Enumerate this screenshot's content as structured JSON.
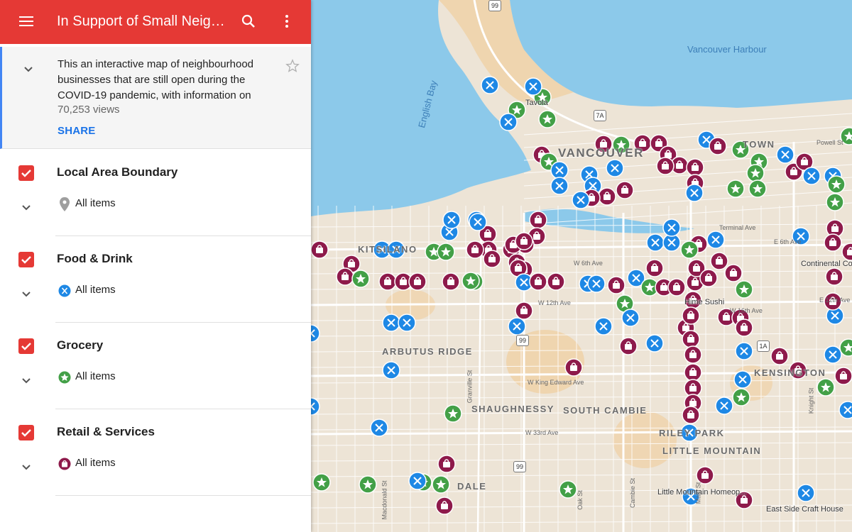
{
  "header": {
    "title": "In Support of Small Neighbourhood Businesses",
    "menu_icon": "hamburger-icon",
    "search_icon": "search-icon",
    "more_icon": "more-vert-icon",
    "bar_color": "#e53935"
  },
  "description": {
    "text": "This an interactive map of neighbourhood businesses that are still open during the COVID-19 pandemic, with information on",
    "views": "70,253 views",
    "share_label": "SHARE"
  },
  "layers": [
    {
      "name": "Local Area Boundary",
      "items_label": "All items",
      "icon": "gray-pin-icon",
      "color": "#9e9e9e"
    },
    {
      "name": "Food & Drink",
      "items_label": "All items",
      "icon": "fork-knife-icon",
      "color": "#1e88e5"
    },
    {
      "name": "Grocery",
      "items_label": "All items",
      "icon": "star-icon",
      "color": "#43a047"
    },
    {
      "name": "Retail & Services",
      "items_label": "All items",
      "icon": "shop-bag-icon",
      "color": "#8e1a4b"
    }
  ],
  "map": {
    "water_labels": [
      "Vancouver Harbour",
      "English Bay"
    ],
    "place_labels": [
      "Tavola",
      "Hime Sushi",
      "Continental Coffee",
      "Little Mountain Homeop...",
      "East Side Craft House"
    ],
    "area_labels": [
      "ARBUTUS RIDGE",
      "SHAUGHNESSY",
      "SOUTH CAMBIE",
      "RILEY PARK",
      "LITTLE MOUNTAIN",
      "KITSILANO",
      "VANCOUVER",
      "TOWN",
      "KENSINGTON",
      "DALE"
    ],
    "street_labels": [
      "W 6th Ave",
      "W 12th Ave",
      "W King Edward Ave",
      "W 33rd Ave",
      "E 12th Ave",
      "E 6th Ave",
      "Terminal Ave",
      "W 16th Ave",
      "Powell St",
      "Oak St",
      "Cambie St",
      "Main St",
      "Knight St",
      "Macdonald St",
      "Granville St"
    ],
    "highway_shields": [
      "99",
      "99",
      "99",
      "7A",
      "1A"
    ]
  }
}
